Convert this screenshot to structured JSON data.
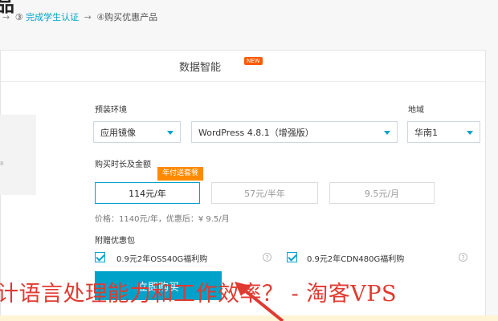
{
  "header": {
    "title_fragment": "品",
    "steps": {
      "prefix": "→",
      "step3_num": "③",
      "step3_label": "完成学生认证",
      "arrow": "→",
      "step4": "④购买优惠产品"
    }
  },
  "panel": {
    "title": "数据智能",
    "badge": "NEW",
    "left_hint": "8",
    "env": {
      "label": "预装环境",
      "image_select": "应用镜像",
      "app_select": "WordPress 4.8.1（增强版）"
    },
    "region": {
      "label": "地域",
      "value": "华南1"
    },
    "duration": {
      "label": "购买时长及金额",
      "promo_tag": "年付送套餐",
      "options": [
        "114元/年",
        "57元/半年",
        "9.5元/月"
      ],
      "selected_index": 0,
      "price_note": "价格：1140元/年，优惠后：¥ 9.5/月"
    },
    "bonus": {
      "label": "附赠优惠包",
      "items": [
        {
          "label": "0.9元2年OSS40G福利购",
          "checked": true
        },
        {
          "label": "0.9元2年CDN480G福利购",
          "checked": true
        }
      ],
      "help_glyph": "?"
    },
    "buy_button": "立即购买"
  },
  "watermark": "计语言处理能力和工作效率？ - 淘客VPS",
  "colors": {
    "accent": "#00a2ca",
    "promo": "#ff8a00",
    "watermark": "#e03a30",
    "arrow": "#e03a30"
  }
}
